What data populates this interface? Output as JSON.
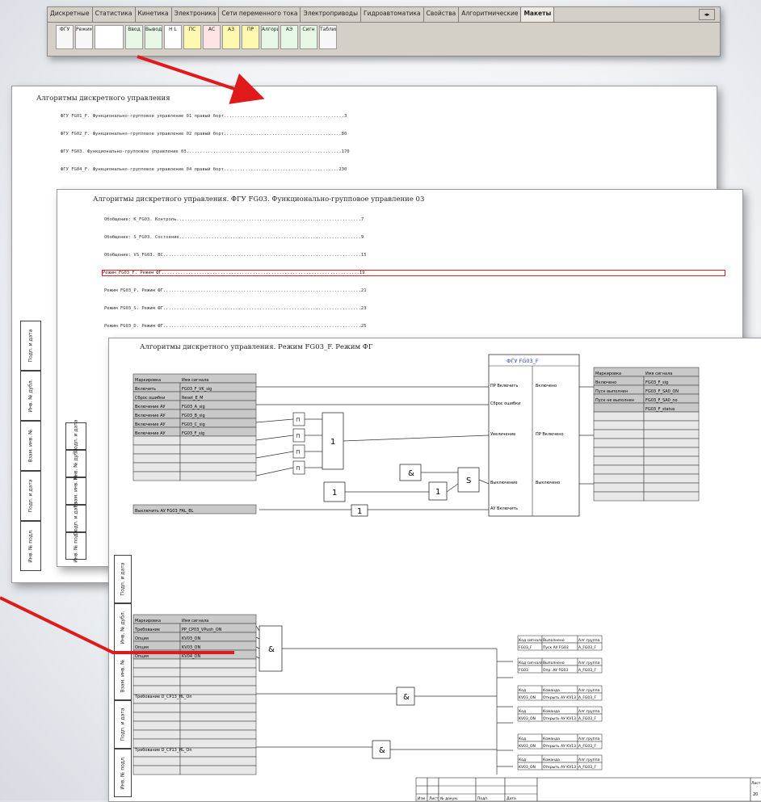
{
  "toolbar": {
    "tabs": [
      "Дискретные",
      "Статистика",
      "Кинетика",
      "Электроника",
      "Сети переменного тока",
      "Электроприводы",
      "Гидроавтоматика",
      "Свойства",
      "Алгоритмические",
      "Макеты"
    ],
    "tools": [
      "ФГУ",
      "Режим",
      "",
      "Ввод",
      "Вывод",
      "Н L",
      "ПС",
      "АС",
      "АЗ",
      "ПР",
      "Алгоритм",
      "АЭ",
      "Сигн",
      "Таблица"
    ]
  },
  "sheet1": {
    "title": "Алгоритмы дискретного управления",
    "rows": [
      "ФГУ FG01_F. Функционально-групповое управление 01 правый борт.............................................3",
      "ФГУ FG02_F. Функционально-групповое управление 02 правый борт............................................80",
      "ФГУ FG03. Функционально-групповое управление 03..........................................................170",
      "ФГУ FG04_F. Функционально-групповое управление 04 правый борт...........................................230"
    ],
    "stamp_cells": [
      "Подп. и дата",
      "Инв. № дубл.",
      "Взам. инв. №",
      "Подп. и дата",
      "Инв. № подл."
    ]
  },
  "sheet2": {
    "title": "Алгоритмы дискретного управления. ФГУ FG03. Функционально-групповое управление 03",
    "rows": [
      "Обобщение: K_FG03. Контроль.....................................................................7",
      "Обобщение: S_FG03. Состояние....................................................................9",
      "Обобщение: VS_FG03. ВС..........................................................................15",
      "Режим FG03_F. Режим ФГ..........................................................................19",
      "Режим FG03_P. Режим ФГ..........................................................................21",
      "Режим FG03_S. Режим ФГ..........................................................................23",
      "Режим FG03_D. Режим ФГ..........................................................................25"
    ],
    "selected_row": 3,
    "stamp_cells": [
      "Подп. и дата",
      "Инв. № дубл.",
      "Взам. инв. №",
      "Подп. и дата",
      "Инв. № подл."
    ]
  },
  "sheet3": {
    "title": "Алгоритмы дискретного управления. Режим FG03_F. Режим ФГ",
    "fgu": {
      "title": "ФГУ FG03_F",
      "in_labels": [
        "ПР Включить",
        "Сброс ошибки",
        "Увеличение",
        "Выключение",
        "АУ Включить"
      ],
      "out_labels": [
        "Включено",
        "ПР Включено",
        "Выключено"
      ]
    },
    "left_header": [
      "Маркировка",
      "Имя сигнала"
    ],
    "left_rows": [
      [
        "Включить",
        "FG03_F_VK_sig"
      ],
      [
        "Сброс ошибки",
        "Reset_E_M"
      ],
      [
        "Включение АУ",
        "FG03_A_sig"
      ],
      [
        "Включение АУ",
        "FG03_B_sig"
      ],
      [
        "Включение АУ",
        "FG03_C_sig"
      ],
      [
        "Включение АУ",
        "FG03_F_sig"
      ]
    ],
    "left_lower": [
      "Выключить АУ",
      "FG03_FAL_BL"
    ],
    "right_header": [
      "Маркировка",
      "Имя сигнала"
    ],
    "right_rows": [
      [
        "Включено",
        "FG03_F_sig"
      ],
      [
        "Пуск выполнен",
        "FG03_F_SA0_ON"
      ],
      [
        "Пуск не выполнен",
        "FG03_F_SA0_no"
      ],
      [
        "",
        "FG03_F_status"
      ]
    ],
    "gates": {
      "or": "1",
      "and": "&",
      "not": "1"
    },
    "lower_header": [
      "Маркировка",
      "Имя сигнала"
    ],
    "lower_rows": [
      [
        "Требование",
        "PP_CP03_VPush_ON"
      ],
      [
        "Опция",
        "KV03_ON"
      ],
      [
        "Опция",
        "KV03_ON"
      ],
      [
        "Опция",
        "KV04_ON"
      ],
      [
        "Требование",
        "D_CP13_HL_On"
      ],
      [
        "Требование",
        "D_CP13_HL_On"
      ]
    ],
    "cmd_tables": [
      {
        "h": [
          "Код сигнала",
          "Выполнено",
          "Алг.группа"
        ],
        "r": [
          "FG03_F",
          "Пуск АУ FG03",
          "A_FG03_F"
        ]
      },
      {
        "h": [
          "Код сигнала",
          "Выполнено",
          "Алг.группа"
        ],
        "r": [
          "FG03",
          "Опр. АУ FG03",
          "A_FG03_F"
        ]
      },
      {
        "h": [
          "Код",
          "Команда",
          "Алг.группа"
        ],
        "r": [
          "KV03_ON",
          "Открыть АУ KV13",
          "A_FG03_F"
        ]
      },
      {
        "h": [
          "Код",
          "Команда",
          "Алг.группа"
        ],
        "r": [
          "KV03_ON",
          "Открыть АУ KV13",
          "A_FG03_F"
        ]
      },
      {
        "h": [
          "Код",
          "Команда",
          "Алг.группа"
        ],
        "r": [
          "KV03_ON",
          "Открыть АУ KV13",
          "A_FG03_F"
        ]
      },
      {
        "h": [
          "Код",
          "Команда",
          "Алг.группа"
        ],
        "r": [
          "KV03_ON",
          "Открыть АУ KV13",
          "A_FG03_F"
        ]
      }
    ],
    "stamp": {
      "cols": [
        "Изм",
        "Лист",
        "№ докум.",
        "Подп.",
        "Дата"
      ],
      "sheet_label": "Лист",
      "sheet_no": "20"
    },
    "stamp_cells": [
      "Подп. и дата",
      "Инв. № дубл.",
      "Взам. инв. №",
      "Подп. и дата",
      "Инв. № подл."
    ]
  },
  "colors": {
    "arrow": "#e01a1a",
    "selection": "#e81c1c",
    "fgu_blue": "#1f3fd0",
    "grey_cell": "#c9c9c9"
  }
}
